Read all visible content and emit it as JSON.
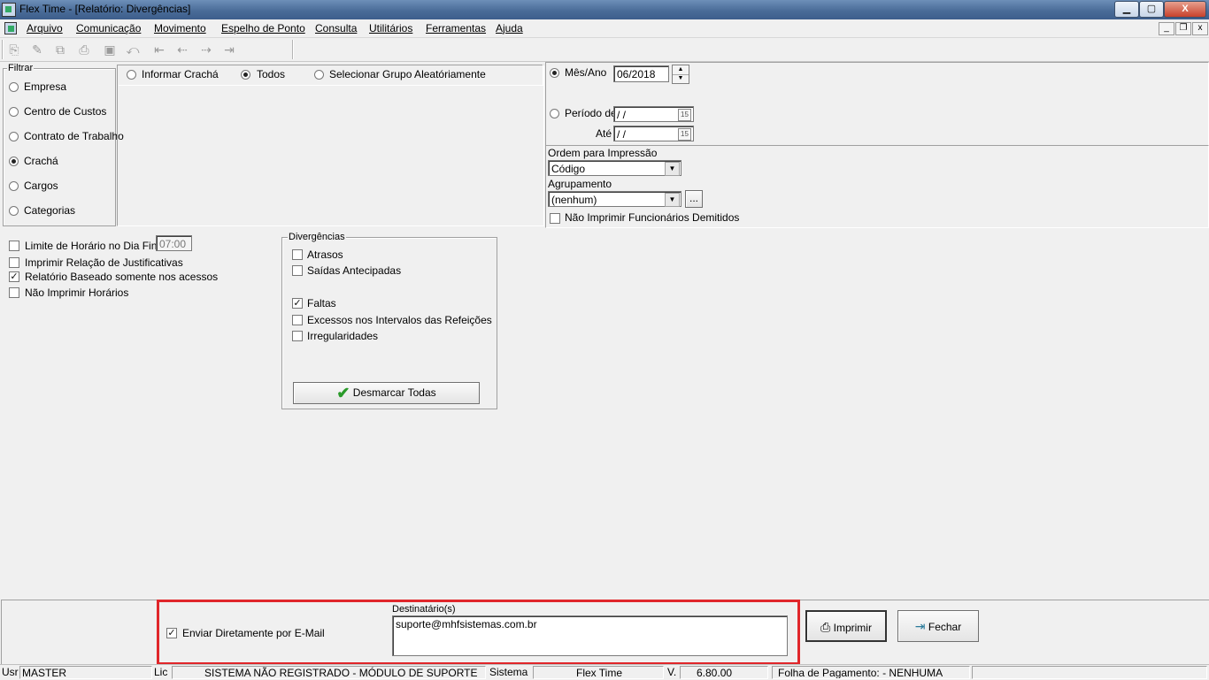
{
  "window": {
    "title": "Flex Time - [Relatório: Divergências]",
    "minimize": "▁",
    "maximize": "▢",
    "close": "X"
  },
  "menu": [
    "Arquivo",
    "Comunicação",
    "Movimento",
    "Espelho de Ponto",
    "Consulta",
    "Utilitários",
    "Ferramentas",
    "Ajuda"
  ],
  "mdi": {
    "minimize": "_",
    "restore": "❐",
    "close": "x"
  },
  "filtrar": {
    "label": "Filtrar",
    "options": [
      "Empresa",
      "Centro de Custos",
      "Contrato de Trabalho",
      "Crachá",
      "Cargos",
      "Categorias"
    ],
    "selected": "Crachá"
  },
  "cracha_mode": {
    "options": [
      "Informar Crachá",
      "Todos",
      "Selecionar Grupo Aleatóriamente"
    ],
    "selected": "Todos"
  },
  "periodo": {
    "mes_ano_label": "Mês/Ano",
    "mes_ano_value": "06/2018",
    "periodo_label": "Período de",
    "ate_label": "Até",
    "date_placeholder": " /  /",
    "cal_glyph": "15",
    "selected": "Mês/Ano"
  },
  "ordem": {
    "label": "Ordem para Impressão",
    "value": "Código"
  },
  "agrupamento": {
    "label": "Agrupamento",
    "value": "(nenhum)",
    "browse": "..."
  },
  "nao_imprimir_demitidos": {
    "label": "Não Imprimir Funcionários Demitidos",
    "checked": false
  },
  "options": [
    {
      "label": "Limite de Horário no Dia Final",
      "checked": false
    },
    {
      "label": "Imprimir Relação de Justificativas",
      "checked": false
    },
    {
      "label": "Relatório Baseado somente nos acessos",
      "checked": true
    },
    {
      "label": "Não Imprimir Horários",
      "checked": false
    }
  ],
  "limite_horario_value": "07:00",
  "divergencias": {
    "label": "Divergências",
    "items": [
      {
        "label": "Atrasos",
        "checked": false
      },
      {
        "label": "Saídas Antecipadas",
        "checked": false
      },
      {
        "label": "Faltas",
        "checked": true
      },
      {
        "label": "Excessos nos Intervalos das Refeições",
        "checked": false
      },
      {
        "label": "Irregularidades",
        "checked": false
      }
    ],
    "desmarcar_label": "Desmarcar Todas"
  },
  "email": {
    "enviar_label": "Enviar Diretamente por E-Mail",
    "enviar_checked": true,
    "destinatarios_label": "Destinatário(s)",
    "destinatarios_value": "suporte@mhfsistemas.com.br"
  },
  "buttons": {
    "imprimir": "Imprimir",
    "fechar": "Fechar"
  },
  "statusbar": {
    "usr_label": "Usr",
    "usr_value": "MASTER",
    "lic_label": "Lic",
    "lic_value": "SISTEMA NÃO REGISTRADO - MÓDULO DE SUPORTE",
    "sistema_label": "Sistema",
    "sistema_value": "Flex Time",
    "versao_label": "V.",
    "versao_value": "6.80.00",
    "folha": "Folha de Pagamento:  - NENHUMA"
  },
  "colors": {
    "highlight": "#e0262a",
    "titlebar": "#4a6c98",
    "check_green": "#2a9a2a"
  }
}
